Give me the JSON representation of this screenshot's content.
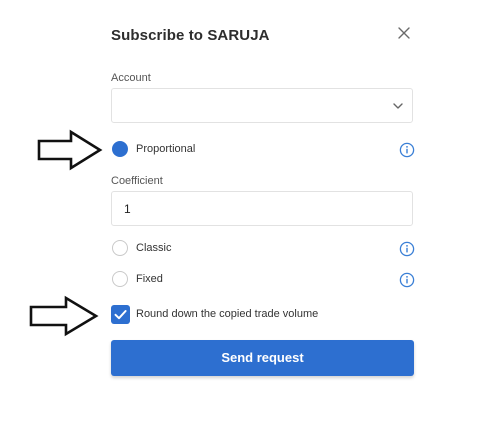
{
  "dialog": {
    "title": "Subscribe to SARUJA",
    "close_icon": "close-icon"
  },
  "account": {
    "label": "Account",
    "value": "",
    "icon": "chevron-down-icon"
  },
  "options": {
    "proportional": {
      "label": "Proportional",
      "selected": true
    },
    "coefficient": {
      "label": "Coefficient",
      "value": "1"
    },
    "classic": {
      "label": "Classic",
      "selected": false
    },
    "fixed": {
      "label": "Fixed",
      "selected": false
    },
    "info_icon": "info-icon"
  },
  "round_down": {
    "label": "Round down the copied trade volume",
    "checked": true
  },
  "send_button": {
    "label": "Send request"
  },
  "annotations": {
    "arrow_icon": "arrow-right-icon"
  },
  "colors": {
    "accent": "#2d6fd0",
    "border": "#e2e2e2",
    "info": "#3a7fd6"
  }
}
